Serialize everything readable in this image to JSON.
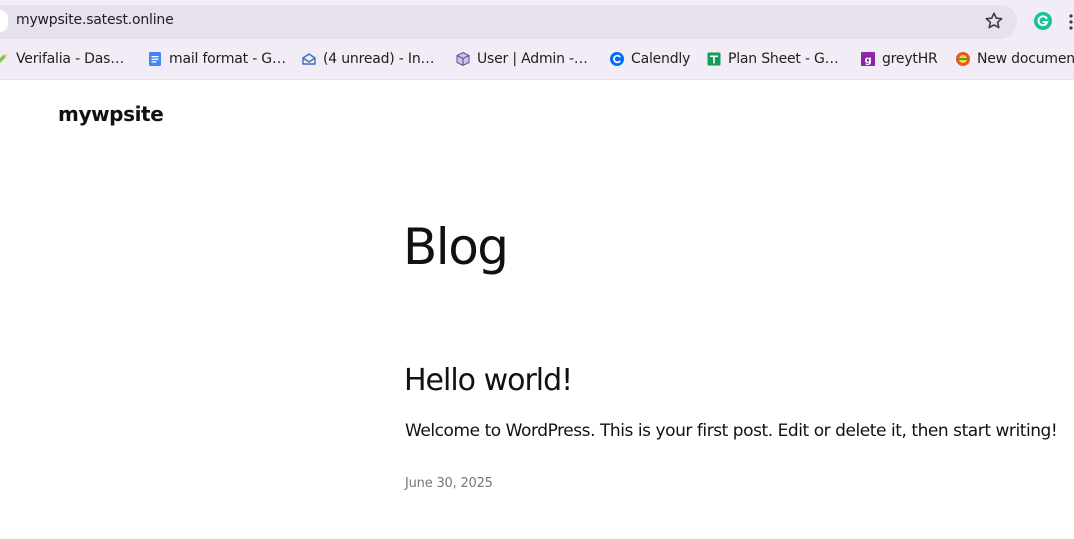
{
  "browser": {
    "url": "mywpsite.satest.online",
    "bookmarks": [
      {
        "label": "Verifalia - Das…",
        "icon": "verifalia-icon"
      },
      {
        "label": "mail format - G…",
        "icon": "google-docs-icon"
      },
      {
        "label": "(4 unread) - In…",
        "icon": "mail-icon"
      },
      {
        "label": "User | Admin -…",
        "icon": "cube-icon"
      },
      {
        "label": "Calendly",
        "icon": "calendly-icon"
      },
      {
        "label": "Plan Sheet - G…",
        "icon": "google-sheets-icon"
      },
      {
        "label": "greytHR",
        "icon": "greythr-icon"
      },
      {
        "label": "New documen",
        "icon": "document-icon"
      }
    ]
  },
  "site": {
    "title": "mywpsite"
  },
  "main": {
    "heading": "Blog",
    "posts": [
      {
        "title": "Hello world!",
        "excerpt": "Welcome to WordPress. This is your first post. Edit or delete it, then start writing!",
        "date": "June 30, 2025"
      }
    ]
  },
  "colors": {
    "chrome_bg": "#f1ecf5",
    "urlbar_bg": "#e6e1ec",
    "text": "#111111",
    "date_text": "#777777"
  }
}
